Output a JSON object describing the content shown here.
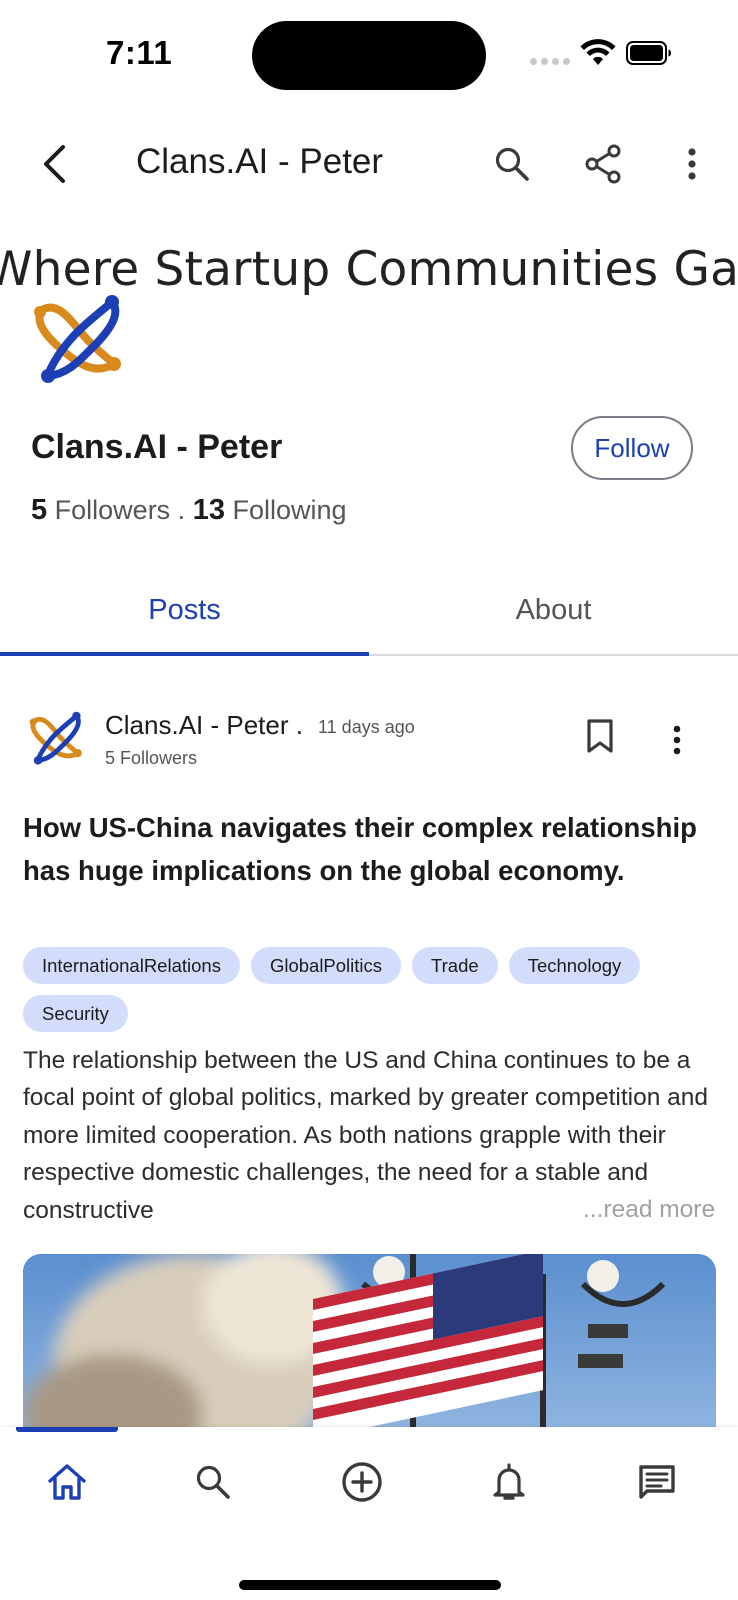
{
  "status_bar": {
    "time": "7:11"
  },
  "app_bar": {
    "title": "Clans.AI - Peter"
  },
  "banner": {
    "text": "Where Startup Communities Gather"
  },
  "profile": {
    "name": "Clans.AI - Peter",
    "follow_label": "Follow",
    "followers_count": "5",
    "followers_label": "Followers .",
    "following_count": "13",
    "following_label": "Following"
  },
  "tabs": [
    {
      "label": "Posts",
      "active": true
    },
    {
      "label": "About",
      "active": false
    }
  ],
  "post": {
    "author": "Clans.AI - Peter .",
    "time_ago": "11 days ago",
    "author_followers": "5 Followers",
    "title": "How US-China navigates their complex relationship has huge implications on the global economy.",
    "tags": [
      "InternationalRelations",
      "GlobalPolitics",
      "Trade",
      "Technology",
      "Security"
    ],
    "body": "The relationship between the US and China continues to be a focal point of global politics, marked by greater competition and more limited cooperation. As both nations grapple with their respective domestic challenges, the need for a stable and constructive",
    "read_more": "...read more"
  },
  "bottom_nav": [
    "home-icon",
    "search-icon",
    "add-circle-icon",
    "bell-icon",
    "chat-icon"
  ],
  "colors": {
    "accent": "#1c3fb6",
    "tag_bg": "#d3dcfb",
    "logo_orange": "#d98a1c",
    "logo_blue": "#1c3fb6"
  }
}
